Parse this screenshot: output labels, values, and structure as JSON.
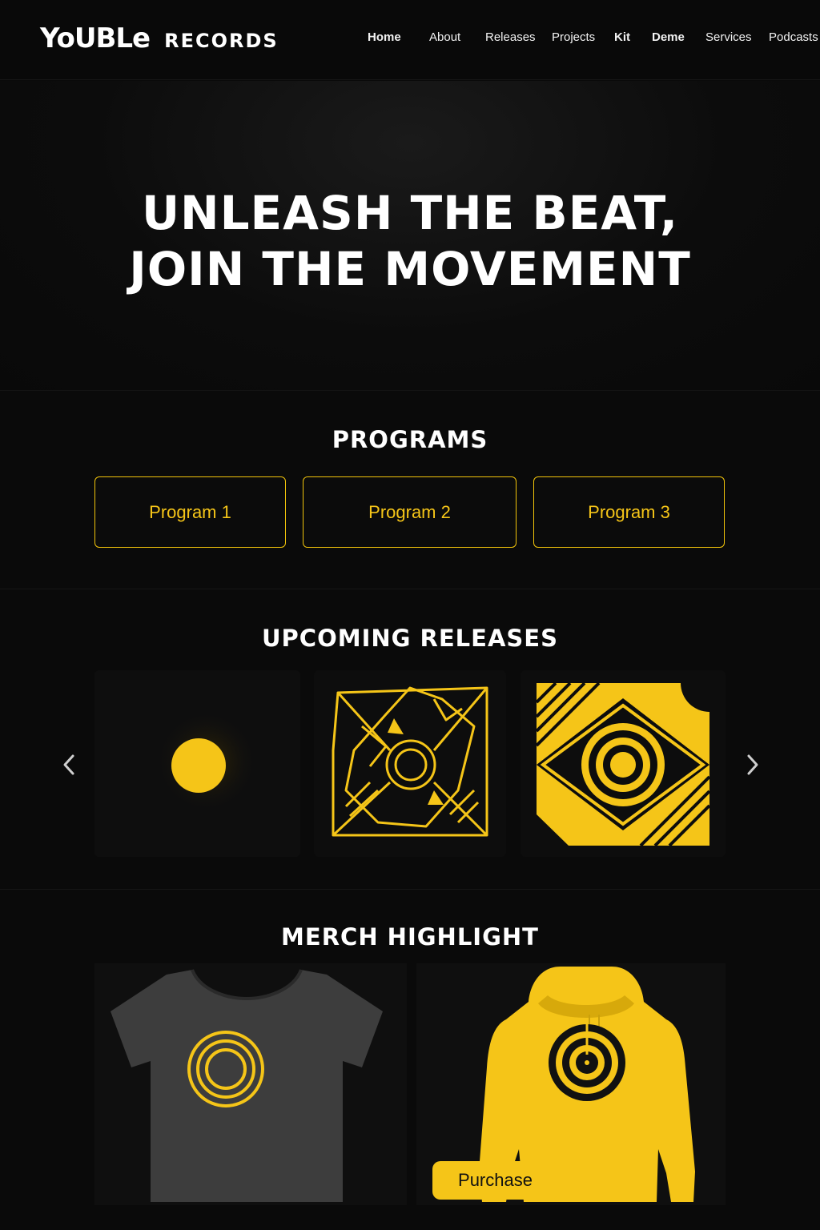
{
  "brand": {
    "name": "YoUBLe",
    "sub": "RECORDS"
  },
  "nav": {
    "items": [
      {
        "label": "Home"
      },
      {
        "label": "About"
      },
      {
        "label": "Releases"
      },
      {
        "label": "Projects"
      },
      {
        "label": "Kit"
      },
      {
        "label": "Deme"
      },
      {
        "label": "Services"
      },
      {
        "label": "Podcasts"
      }
    ]
  },
  "hero": {
    "line1": "UNLEASH THE BEAT,",
    "line2": "JOIN THE MOVEMENT"
  },
  "programs": {
    "title": "PROGRAMS",
    "items": [
      {
        "label": "Program 1"
      },
      {
        "label": "Program 2"
      },
      {
        "label": "Program 3"
      }
    ]
  },
  "releases": {
    "title": "UPCOMING RELEASES",
    "prev_icon": "chevron-left-icon",
    "next_icon": "chevron-right-icon"
  },
  "merch": {
    "title": "MERCH HIGHLIGHT",
    "purchase_label": "Purchase"
  },
  "colors": {
    "accent": "#f5c518",
    "background": "#0a0a0a",
    "text": "#ffffff"
  }
}
